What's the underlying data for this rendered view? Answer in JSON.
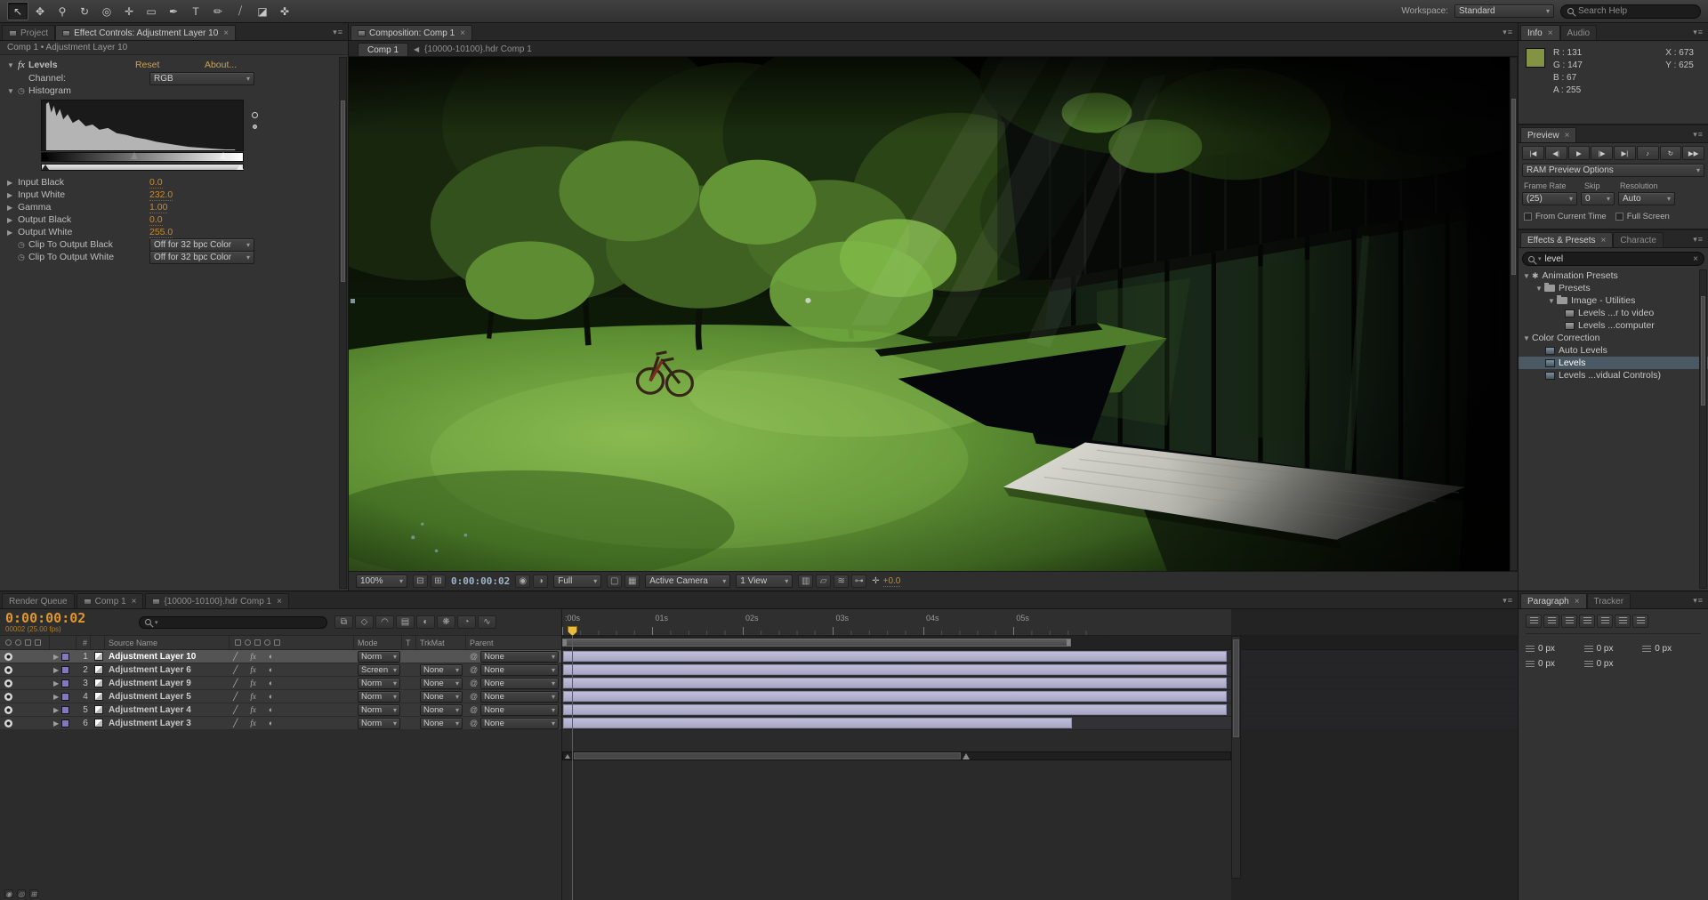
{
  "ui": {
    "caret": "▾",
    "close": "×",
    "twirl_open": "▼",
    "twirl_closed": "▶",
    "menu": "▾≡",
    "back_arrow": "◀",
    "stopwatch": "◷",
    "pickwhip": "@",
    "star": "✱"
  },
  "toolbar": {
    "tools": [
      {
        "name": "selection-tool",
        "glyph": "↖",
        "active": true
      },
      {
        "name": "hand-tool",
        "glyph": "✥"
      },
      {
        "name": "zoom-tool",
        "glyph": "⚲"
      },
      {
        "name": "rotation-tool",
        "glyph": "↻"
      },
      {
        "name": "unified-camera-tool",
        "glyph": "◎"
      },
      {
        "name": "pan-behind-tool",
        "glyph": "✛"
      },
      {
        "name": "mask-shape-tool",
        "glyph": "▭"
      },
      {
        "name": "pen-tool",
        "glyph": "✒"
      },
      {
        "name": "type-tool",
        "glyph": "T"
      },
      {
        "name": "brush-tool",
        "glyph": "✏"
      },
      {
        "name": "clone-stamp-tool",
        "glyph": "⧸"
      },
      {
        "name": "eraser-tool",
        "glyph": "◪"
      },
      {
        "name": "puppet-pin-tool",
        "glyph": "✜"
      }
    ],
    "workspace_label": "Workspace:",
    "workspace_value": "Standard",
    "search_placeholder": "Search Help"
  },
  "effect_controls": {
    "tab_project": "Project",
    "tab_title": "Effect Controls: Adjustment Layer 10",
    "breadcrumb": "Comp 1 • Adjustment Layer 10",
    "effect": {
      "name": "Levels",
      "reset": "Reset",
      "about": "About...",
      "channel_label": "Channel:",
      "channel_value": "RGB",
      "histogram_label": "Histogram",
      "params": [
        {
          "label": "Input Black",
          "value": "0.0"
        },
        {
          "label": "Input White",
          "value": "232.0"
        },
        {
          "label": "Gamma",
          "value": "1.00"
        },
        {
          "label": "Output Black",
          "value": "0.0"
        },
        {
          "label": "Output White",
          "value": "255.0"
        }
      ],
      "clip_black_label": "Clip To Output Black",
      "clip_white_label": "Clip To Output White",
      "clip_value": "Off for 32 bpc Color"
    }
  },
  "composition": {
    "panel_tab": "Composition: Comp 1",
    "comp_tab": "Comp 1",
    "comp_tab2": "{10000-10100}.hdr Comp 1",
    "footer": {
      "zoom": "100%",
      "timecode": "0:00:00:02",
      "resolution": "Full",
      "camera": "Active Camera",
      "view": "1 View",
      "exposure": "+0.0",
      "exposure_icon": "✛"
    },
    "viewer_icons_a": [
      {
        "name": "safe-margins-icon",
        "glyph": "⊟"
      },
      {
        "name": "grid-guides-icon",
        "glyph": "⊞"
      }
    ],
    "viewer_icons_b": [
      {
        "name": "snapshot-icon",
        "glyph": "◉"
      },
      {
        "name": "show-channel-icon",
        "glyph": "◑"
      }
    ],
    "viewer_icons_c": [
      {
        "name": "region-of-interest-icon",
        "glyph": "▢"
      },
      {
        "name": "transparency-grid-icon",
        "glyph": "▦"
      }
    ],
    "viewer_icons_d": [
      {
        "name": "view-layout-icon",
        "glyph": "▥"
      },
      {
        "name": "pixel-aspect-icon",
        "glyph": "▱"
      },
      {
        "name": "fast-preview-icon",
        "glyph": "≋"
      },
      {
        "name": "mini-flowchart-icon",
        "glyph": "⊶"
      }
    ]
  },
  "info": {
    "tab": "Info",
    "tab2": "Audio",
    "swatch_color": "#839343",
    "r": "R : 131",
    "g": "G : 147",
    "b": "B : 67",
    "a": "A : 255",
    "x": "X : 673",
    "y": "Y : 625"
  },
  "preview": {
    "tab": "Preview",
    "transport": [
      {
        "name": "first-frame-button",
        "glyph": "|◀"
      },
      {
        "name": "previous-frame-button",
        "glyph": "◀|"
      },
      {
        "name": "play-button",
        "glyph": "▶"
      },
      {
        "name": "next-frame-button",
        "glyph": "|▶"
      },
      {
        "name": "last-frame-button",
        "glyph": "▶|"
      },
      {
        "name": "audio-button",
        "glyph": "♪"
      },
      {
        "name": "loop-button",
        "glyph": "↻"
      },
      {
        "name": "ram-preview-button",
        "glyph": "▶▶"
      }
    ],
    "ram_options": "RAM Preview Options",
    "frame_rate_label": "Frame Rate",
    "skip_label": "Skip",
    "resolution_label": "Resolution",
    "frame_rate_value": "(25)",
    "skip_value": "0",
    "resolution_value": "Auto",
    "from_current_time": "From Current Time",
    "full_screen": "Full Screen"
  },
  "effects_presets": {
    "tab": "Effects & Presets",
    "tab2": "Characte",
    "search_value": "level",
    "tree": {
      "animation_presets": "Animation Presets",
      "presets": "Presets",
      "image_utilities": "Image - Utilities",
      "preset_video": "Levels ...r to video",
      "preset_computer": "Levels ...computer",
      "color_correction": "Color Correction",
      "auto_levels": "Auto Levels",
      "levels": "Levels",
      "levels_individual": "Levels ...vidual Controls)"
    }
  },
  "timeline": {
    "tabs": [
      {
        "name": "tab-render-queue",
        "label": "Render Queue"
      },
      {
        "name": "tab-comp-1",
        "label": "Comp 1",
        "active": true,
        "icon": true,
        "closex": true
      },
      {
        "name": "tab-hdr-comp-1",
        "label": "{10000-10100}.hdr Comp 1",
        "icon": true,
        "closex": true
      }
    ],
    "timecode": "0:00:00:02",
    "frame_info": "00002 (25.00 fps)",
    "toolbar_icons": [
      {
        "name": "composition-mini-flowchart-icon",
        "glyph": "⧉"
      },
      {
        "name": "draft-3d-icon",
        "glyph": "◇"
      },
      {
        "name": "hide-shy-layers-icon",
        "glyph": "◠"
      },
      {
        "name": "frame-blending-icon",
        "glyph": "▤"
      },
      {
        "name": "motion-blur-icon",
        "glyph": "◐"
      },
      {
        "name": "brainstorm-icon",
        "glyph": "❋"
      },
      {
        "name": "auto-keyframe-icon",
        "glyph": "◔"
      },
      {
        "name": "graph-editor-icon",
        "glyph": "∿"
      }
    ],
    "columns": {
      "num": "#",
      "source_name": "Source Name",
      "mode": "Mode",
      "t": "T",
      "trkmat": "TrkMat",
      "parent": "Parent"
    },
    "switch_icons": {
      "quality": "╱",
      "fx": "fx",
      "adjustment": "◐"
    },
    "layers": [
      {
        "num": "1",
        "source_name": "Adjustment Layer 10",
        "mode": "Norm",
        "trkmat": "",
        "parent": "None",
        "bar": "69.5%",
        "selected": true,
        "first": true
      },
      {
        "num": "2",
        "source_name": "Adjustment Layer 6",
        "mode": "Screen",
        "trkmat": "None",
        "parent": "None",
        "bar": "69.5%"
      },
      {
        "num": "3",
        "source_name": "Adjustment Layer 9",
        "mode": "Norm",
        "trkmat": "None",
        "parent": "None",
        "bar": "69.5%"
      },
      {
        "num": "4",
        "source_name": "Adjustment Layer 5",
        "mode": "Norm",
        "trkmat": "None",
        "parent": "None",
        "bar": "69.5%"
      },
      {
        "num": "5",
        "source_name": "Adjustment Layer 4",
        "mode": "Norm",
        "trkmat": "None",
        "parent": "None",
        "bar": "69.5%"
      },
      {
        "num": "6",
        "source_name": "Adjustment Layer 3",
        "mode": "Norm",
        "trkmat": "None",
        "parent": "None",
        "bar": "53.3%"
      }
    ],
    "ruler": [
      ":00s",
      "01s",
      "02s",
      "03s",
      "04s",
      "05s"
    ],
    "bottom_icons": [
      {
        "name": "av-features-toggle-icon",
        "glyph": "◉"
      },
      {
        "name": "transfer-controls-toggle-icon",
        "glyph": "◎"
      },
      {
        "name": "inout-panes-toggle-icon",
        "glyph": "⊞"
      }
    ]
  },
  "paragraph": {
    "tab": "Paragraph",
    "tab2": "Tracker",
    "align_buttons": [
      {
        "name": "align-left-button"
      },
      {
        "name": "align-center-button"
      },
      {
        "name": "align-right-button"
      },
      {
        "name": "justify-last-left-button"
      },
      {
        "name": "justify-last-center-button"
      },
      {
        "name": "justify-last-right-button"
      },
      {
        "name": "justify-all-button"
      }
    ],
    "fields": [
      {
        "name": "indent-left-field",
        "value": "0 px"
      },
      {
        "name": "indent-first-line-field",
        "value": "0 px"
      },
      {
        "name": "indent-right-field",
        "value": "0 px"
      },
      {
        "name": "space-before-field",
        "value": "0 px"
      },
      {
        "name": "space-after-field",
        "value": "0 px"
      }
    ]
  }
}
